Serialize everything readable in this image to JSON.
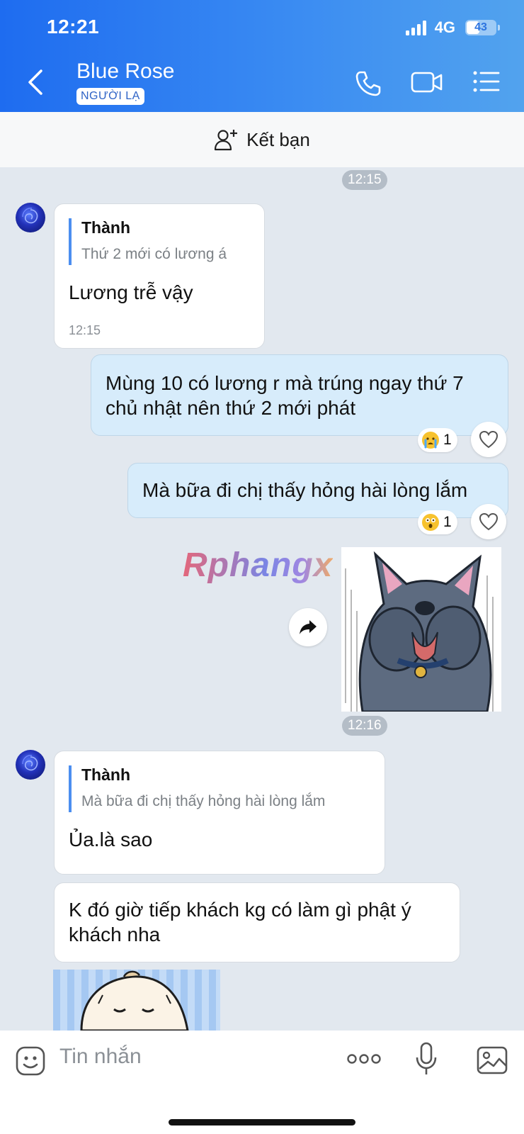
{
  "status_bar": {
    "time": "12:21",
    "network": "4G",
    "battery": "43"
  },
  "header": {
    "title": "Blue Rose",
    "badge": "NGƯỜI LẠ"
  },
  "icons": {
    "back": "chevron-left-icon",
    "call": "phone-icon",
    "video": "video-camera-icon",
    "menu": "list-menu-icon"
  },
  "add_friend": {
    "label": "Kết bạn",
    "icon": "add-user-icon"
  },
  "watermark": "Rphangx",
  "messages": [
    {
      "type": "time",
      "text": "12:15"
    },
    {
      "type": "incoming",
      "quote_name": "Thành",
      "quote_text": "Thứ 2 mới có lương á",
      "text": "Lương trễ vậy",
      "time": "12:15"
    },
    {
      "type": "outgoing",
      "text": "Mùng 10 có lương r mà trúng ngay thứ 7 chủ nhật nên thứ 2 mới phát",
      "reaction_count": "1",
      "reaction_emoji": "crying-face-icon"
    },
    {
      "type": "outgoing",
      "text": "Mà bữa đi chị thấy hỏng hài lòng lắm",
      "reaction_count": "1",
      "reaction_emoji": "astonished-face-icon"
    },
    {
      "type": "sticker",
      "sticker": "crying-cat-sticker"
    },
    {
      "type": "time",
      "text": "12:16"
    },
    {
      "type": "incoming",
      "quote_name": "Thành",
      "quote_text": "Mà bữa đi chị thấy hỏng hài lòng lắm",
      "text": "Ủa.là sao"
    },
    {
      "type": "incoming",
      "text": "K đó giờ tiếp khách kg có làm gì phật ý khách nha"
    },
    {
      "type": "sticker",
      "sticker": "bun-character-sticker"
    }
  ],
  "input": {
    "placeholder": "Tin nhắn"
  },
  "colors": {
    "header_start": "#1e6cf0",
    "header_end": "#52a3ee",
    "outgoing_bubble": "#d7ecfb",
    "incoming_bubble": "#ffffff",
    "chat_bg": "#e2e8ef",
    "quote_bar": "#4b8ef0"
  }
}
